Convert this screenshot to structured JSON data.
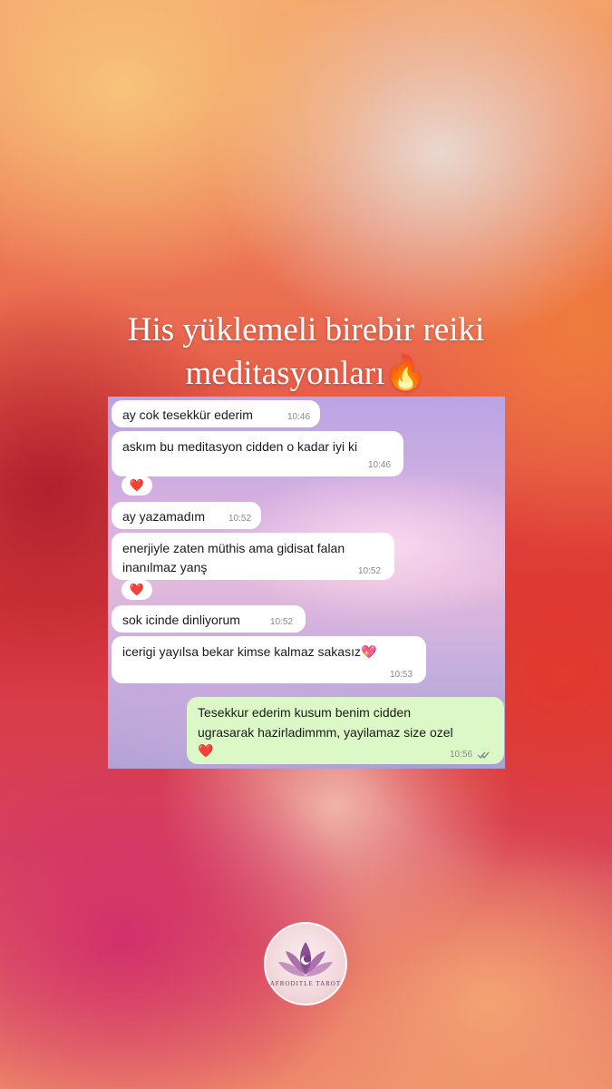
{
  "headline": {
    "line1": "His yüklemeli birebir reiki",
    "line2": "meditasyonları",
    "emoji": "🔥"
  },
  "chat": {
    "messages": [
      {
        "text": "ay cok tesekkür ederim",
        "time": "10:46"
      },
      {
        "text": "askım bu meditasyon cidden o kadar iyi ki",
        "time": "10:46",
        "reaction": "❤️"
      },
      {
        "text": "ay yazamadım",
        "time": "10:52"
      },
      {
        "line1": "enerjiyle zaten müthis ama gidisat falan",
        "line2": "inanılmaz yanş",
        "time": "10:52",
        "reaction": "❤️"
      },
      {
        "text": "sok icinde dinliyorum",
        "time": "10:52"
      },
      {
        "text": "icerigi yayılsa bekar kimse kalmaz sakasız💖",
        "time": "10:53"
      },
      {
        "line1": "Tesekkur ederim kusum benim cidden",
        "line2": "ugrasarak hazirladimmm, yayilamaz size ozel",
        "emoji": "❤️",
        "time": "10:56",
        "status": "read"
      }
    ]
  },
  "logo": {
    "text": "AFRODITLE TAROT",
    "colors": {
      "petal": "#7a3f86",
      "moon": "#ffffff"
    }
  },
  "colors": {
    "incoming_bubble": "#ffffff",
    "outgoing_bubble": "#dcf8c6",
    "read_ticks": "#6b7b8c"
  }
}
